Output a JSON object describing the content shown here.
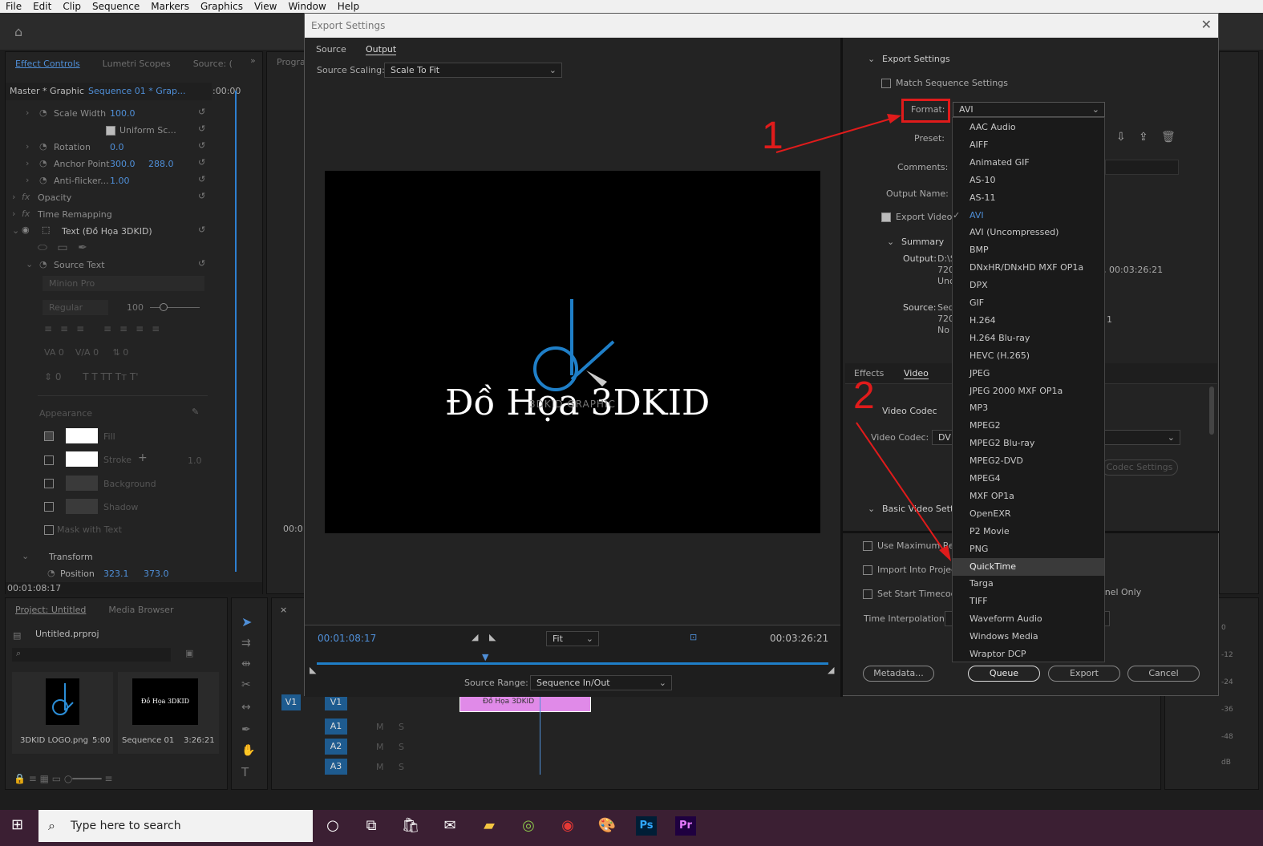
{
  "menu": [
    "File",
    "Edit",
    "Clip",
    "Sequence",
    "Markers",
    "Graphics",
    "View",
    "Window",
    "Help"
  ],
  "effect_controls": {
    "tabs": [
      "Effect Controls",
      "Lumetri Scopes",
      "Source: (",
      "Progra"
    ],
    "master": "Master * Graphic",
    "sequence": "Sequence 01 * Grap...",
    "timecode_top": ":00:00",
    "rows": [
      {
        "label": "Scale Width",
        "value": "100.0"
      },
      {
        "label": "Uniform Sc...",
        "value": ""
      },
      {
        "label": "Rotation",
        "value": "0.0"
      },
      {
        "label": "Anchor Point",
        "value": "300.0",
        "value2": "288.0"
      },
      {
        "label": "Anti-flicker...",
        "value": "1.00"
      }
    ],
    "opacity": "Opacity",
    "time_remapping": "Time Remapping",
    "text_layer": "Text (Đồ Họa 3DKID)",
    "source_text": "Source Text",
    "font": "Minion Pro",
    "style": "Regular",
    "font_size": "100",
    "appearance": "Appearance",
    "fill": "Fill",
    "stroke": "Stroke",
    "stroke_val": "1.0",
    "background": "Background",
    "shadow": "Shadow",
    "mask": "Mask with Text",
    "transform": "Transform",
    "position": "Position",
    "position_x": "323.1",
    "position_y": "373.0",
    "timecode_bottom": "00:01:08:17"
  },
  "project": {
    "tabs": [
      "Project: Untitled",
      "Media Browser"
    ],
    "file": "Untitled.prproj",
    "items": [
      {
        "name": "3DKID LOGO.png",
        "duration": "5:00"
      },
      {
        "name": "Sequence 01",
        "duration": "3:26:21"
      }
    ]
  },
  "timeline": {
    "tracks": [
      "V1",
      "A1",
      "A2",
      "A3"
    ],
    "track_labels": [
      "M",
      "S"
    ],
    "clip": "Đồ Họa 3DKID",
    "meter_ticks": [
      "0",
      "-12",
      "-24",
      "-36",
      "-48",
      "dB"
    ],
    "monitor_tc": "00:0"
  },
  "dialog": {
    "title": "Export Settings",
    "tabs": [
      "Source",
      "Output"
    ],
    "source_scaling_label": "Source Scaling:",
    "source_scaling_value": "Scale To Fit",
    "preview_text": "Đồ Họa 3DKID",
    "preview_sub": "3DKID GRAPHIC",
    "timecode_current": "00:01:08:17",
    "timecode_end": "00:03:26:21",
    "fit": "Fit",
    "source_range_label": "Source Range:",
    "source_range_value": "Sequence In/Out",
    "export_settings_heading": "Export Settings",
    "match_sequence": "Match Sequence Settings",
    "format_label": "Format:",
    "format_value": "AVI",
    "preset_label": "Preset:",
    "comments_label": "Comments:",
    "output_name_label": "Output Name:",
    "export_video": "Export Video",
    "summary": "Summary",
    "output_label": "Output:",
    "output_lines": [
      "D:\\S",
      "720",
      "Unc"
    ],
    "output_tc": ", 00:03:26:21",
    "source_label": "Source:",
    "source_lines": [
      "Seq",
      "720",
      "No"
    ],
    "source_tail": "1",
    "lower_tabs": [
      "Effects",
      "Video"
    ],
    "video_codec_heading": "Video Codec",
    "video_codec_label": "Video Codec:",
    "video_codec_value": "DV",
    "codec_settings": "Codec Settings",
    "basic_video": "Basic Video Setti",
    "use_max": "Use Maximum Ren",
    "import_project": "Import Into Project",
    "set_start_tc": "Set Start Timecode",
    "channel_only": "annel Only",
    "time_interp_label": "Time Interpolation:",
    "time_interp_value": "F",
    "buttons": {
      "metadata": "Metadata...",
      "queue": "Queue",
      "export": "Export",
      "cancel": "Cancel"
    }
  },
  "format_dropdown": {
    "items": [
      "AAC Audio",
      "AIFF",
      "Animated GIF",
      "AS-10",
      "AS-11",
      "AVI",
      "AVI (Uncompressed)",
      "BMP",
      "DNxHR/DNxHD MXF OP1a",
      "DPX",
      "GIF",
      "H.264",
      "H.264 Blu-ray",
      "HEVC (H.265)",
      "JPEG",
      "JPEG 2000 MXF OP1a",
      "MP3",
      "MPEG2",
      "MPEG2 Blu-ray",
      "MPEG2-DVD",
      "MPEG4",
      "MXF OP1a",
      "OpenEXR",
      "P2 Movie",
      "PNG",
      "QuickTime",
      "Targa",
      "TIFF",
      "Waveform Audio",
      "Windows Media",
      "Wraptor DCP"
    ],
    "selected": "AVI",
    "highlighted": "QuickTime"
  },
  "annotations": {
    "step1": "1",
    "step2": "2",
    "color": "#e01b1b"
  },
  "taskbar": {
    "search_placeholder": "Type here to search"
  },
  "colors": {
    "accent": "#4f8fd8",
    "annotation": "#e01b1b",
    "taskbar": "#3b1f33"
  }
}
